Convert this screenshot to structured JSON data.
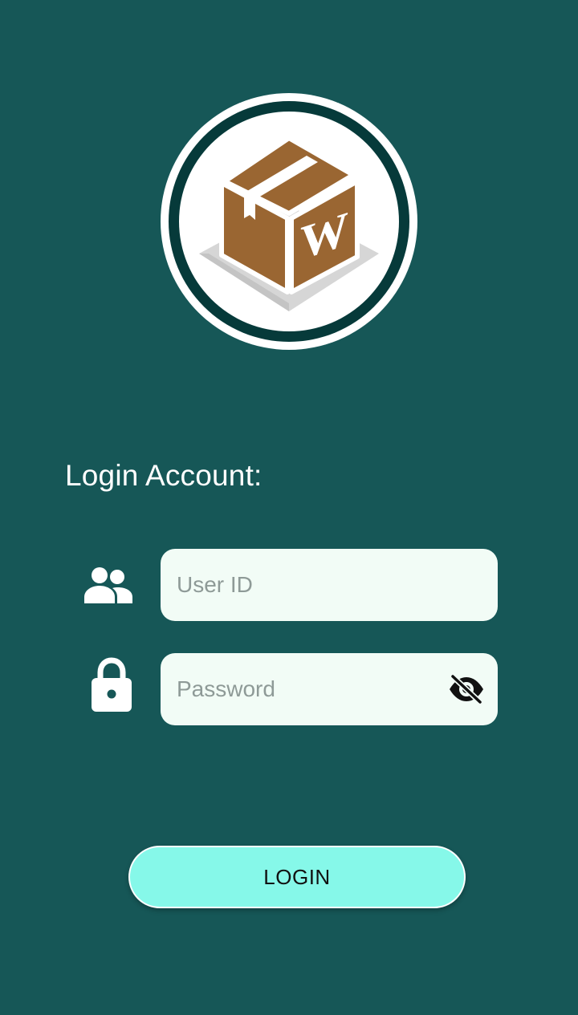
{
  "logo": {
    "icon": "box-w-logo",
    "letter": "W"
  },
  "login": {
    "heading": "Login Account:"
  },
  "user_field": {
    "icon": "users-icon",
    "placeholder": "User ID",
    "value": ""
  },
  "password_field": {
    "icon": "lock-icon",
    "placeholder": "Password",
    "value": "",
    "toggle_icon": "eye-off-icon"
  },
  "login_button": {
    "label": "LOGIN"
  },
  "colors": {
    "background": "#165757",
    "field_background": "#f2fcf6",
    "button_background": "#86f8e9",
    "box_brown": "#9a6632",
    "logo_ring": "#063a3a"
  }
}
